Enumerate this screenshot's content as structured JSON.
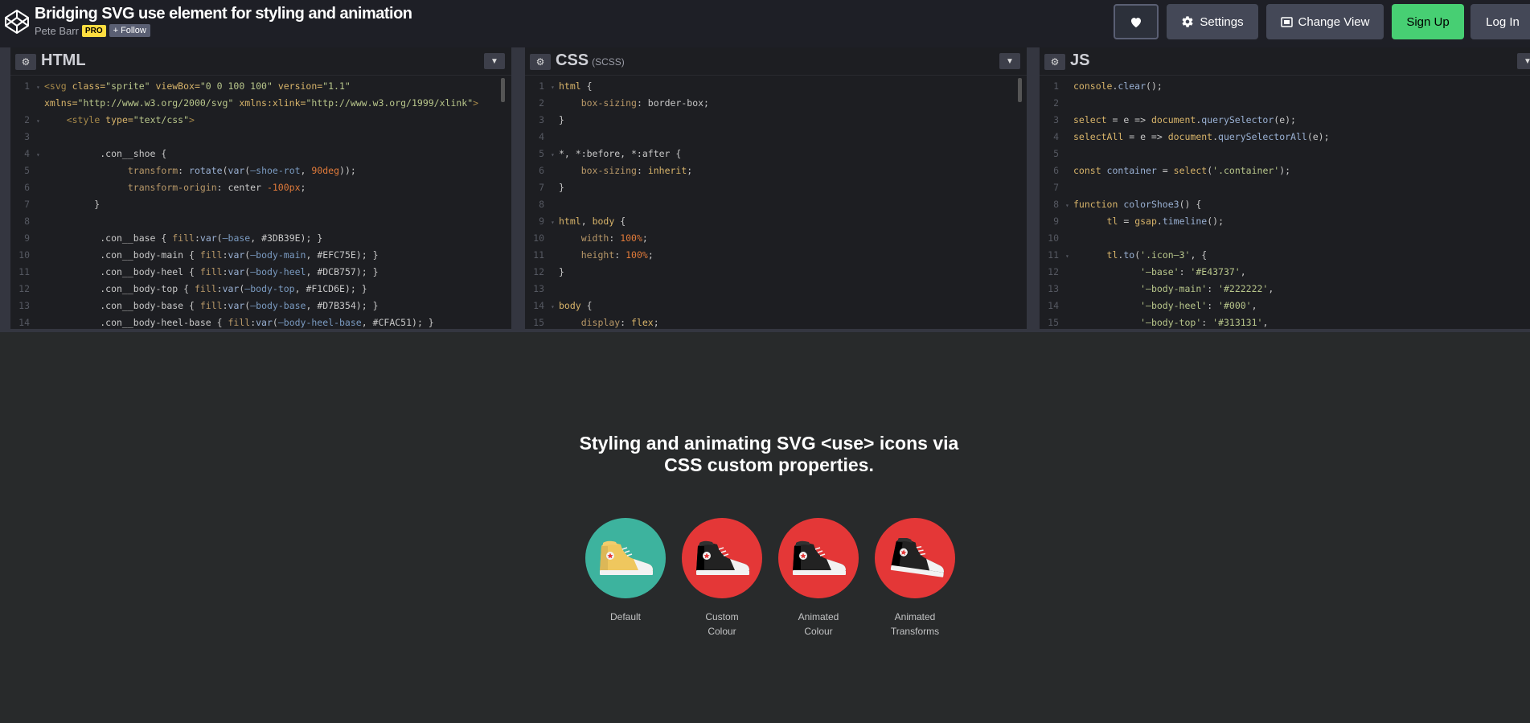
{
  "header": {
    "title": "Bridging SVG use element for styling and animation",
    "author": "Pete Barr",
    "pro_badge": "PRO",
    "follow_label": "+ Follow",
    "settings_label": "Settings",
    "change_view_label": "Change View",
    "signup_label": "Sign Up",
    "login_label": "Log In"
  },
  "panes": {
    "html": {
      "title": "HTML"
    },
    "css": {
      "title": "CSS",
      "subtitle": "(SCSS)"
    },
    "js": {
      "title": "JS"
    }
  },
  "html_code": [
    {
      "n": "1",
      "fold": "▾",
      "segs": [
        [
          "t-tag",
          "<svg "
        ],
        [
          "t-attr",
          "class="
        ],
        [
          "t-str",
          "\"sprite\""
        ],
        [
          "t-attr",
          " viewBox="
        ],
        [
          "t-str",
          "\"0 0 100 100\""
        ],
        [
          "t-attr",
          " version="
        ],
        [
          "t-str",
          "\"1.1\""
        ]
      ]
    },
    {
      "n": "",
      "fold": "",
      "segs": [
        [
          "t-attr",
          "xmlns="
        ],
        [
          "t-str",
          "\"http://www.w3.org/2000/svg\""
        ],
        [
          "t-attr",
          " xmlns:xlink="
        ],
        [
          "t-str",
          "\"http://www.w3.org/1999/xlink\""
        ],
        [
          "t-tag",
          ">"
        ]
      ]
    },
    {
      "n": "2",
      "fold": "▾",
      "segs": [
        [
          "",
          "    "
        ],
        [
          "t-tag",
          "<style "
        ],
        [
          "t-attr",
          "type="
        ],
        [
          "t-str",
          "\"text/css\""
        ],
        [
          "t-tag",
          ">"
        ]
      ]
    },
    {
      "n": "3",
      "fold": "",
      "segs": []
    },
    {
      "n": "4",
      "fold": "▾",
      "segs": [
        [
          "",
          "          .con__shoe {"
        ]
      ]
    },
    {
      "n": "5",
      "fold": "",
      "segs": [
        [
          "",
          "               "
        ],
        [
          "t-prop",
          "transform"
        ],
        [
          "",
          ": "
        ],
        [
          "t-fn",
          "rotate"
        ],
        [
          "",
          "("
        ],
        [
          "t-fn",
          "var"
        ],
        [
          "",
          "("
        ],
        [
          "t-var",
          "—shoe-rot"
        ],
        [
          "",
          ", "
        ],
        [
          "t-num",
          "90deg"
        ],
        [
          "",
          "));"
        ]
      ]
    },
    {
      "n": "6",
      "fold": "",
      "segs": [
        [
          "",
          "               "
        ],
        [
          "t-prop",
          "transform-origin"
        ],
        [
          "",
          ": center "
        ],
        [
          "t-num",
          "-100px"
        ],
        [
          "",
          ";"
        ]
      ]
    },
    {
      "n": "7",
      "fold": "",
      "segs": [
        [
          "",
          "         }"
        ]
      ]
    },
    {
      "n": "8",
      "fold": "",
      "segs": []
    },
    {
      "n": "9",
      "fold": "",
      "segs": [
        [
          "",
          "          .con__base { "
        ],
        [
          "t-prop",
          "fill"
        ],
        [
          "",
          ":"
        ],
        [
          "t-fn",
          "var"
        ],
        [
          "",
          "("
        ],
        [
          "t-var",
          "—base"
        ],
        [
          "",
          ", #3DB39E); }"
        ]
      ]
    },
    {
      "n": "10",
      "fold": "",
      "segs": [
        [
          "",
          "          .con__body-main { "
        ],
        [
          "t-prop",
          "fill"
        ],
        [
          "",
          ":"
        ],
        [
          "t-fn",
          "var"
        ],
        [
          "",
          "("
        ],
        [
          "t-var",
          "—body-main"
        ],
        [
          "",
          ", #EFC75E); }"
        ]
      ]
    },
    {
      "n": "11",
      "fold": "",
      "segs": [
        [
          "",
          "          .con__body-heel { "
        ],
        [
          "t-prop",
          "fill"
        ],
        [
          "",
          ":"
        ],
        [
          "t-fn",
          "var"
        ],
        [
          "",
          "("
        ],
        [
          "t-var",
          "—body-heel"
        ],
        [
          "",
          ", #DCB757); }"
        ]
      ]
    },
    {
      "n": "12",
      "fold": "",
      "segs": [
        [
          "",
          "          .con__body-top { "
        ],
        [
          "t-prop",
          "fill"
        ],
        [
          "",
          ":"
        ],
        [
          "t-fn",
          "var"
        ],
        [
          "",
          "("
        ],
        [
          "t-var",
          "—body-top"
        ],
        [
          "",
          ", #F1CD6E); }"
        ]
      ]
    },
    {
      "n": "13",
      "fold": "",
      "segs": [
        [
          "",
          "          .con__body-base { "
        ],
        [
          "t-prop",
          "fill"
        ],
        [
          "",
          ":"
        ],
        [
          "t-fn",
          "var"
        ],
        [
          "",
          "("
        ],
        [
          "t-var",
          "—body-base"
        ],
        [
          "",
          ", #D7B354); }"
        ]
      ]
    },
    {
      "n": "14",
      "fold": "",
      "segs": [
        [
          "",
          "          .con__body-heel-base { "
        ],
        [
          "t-prop",
          "fill"
        ],
        [
          "",
          ":"
        ],
        [
          "t-fn",
          "var"
        ],
        [
          "",
          "("
        ],
        [
          "t-var",
          "—body-heel-base"
        ],
        [
          "",
          ", #CFAC51); }"
        ]
      ]
    }
  ],
  "css_code": [
    {
      "n": "1",
      "fold": "▾",
      "segs": [
        [
          "t-kw",
          "html"
        ],
        [
          "",
          " {"
        ]
      ]
    },
    {
      "n": "2",
      "fold": "",
      "segs": [
        [
          "",
          "    "
        ],
        [
          "t-prop",
          "box-sizing"
        ],
        [
          "",
          ": border-box;"
        ]
      ]
    },
    {
      "n": "3",
      "fold": "",
      "segs": [
        [
          "",
          "}"
        ]
      ]
    },
    {
      "n": "4",
      "fold": "",
      "segs": []
    },
    {
      "n": "5",
      "fold": "▾",
      "segs": [
        [
          "",
          "*, *:before, *:after {"
        ]
      ]
    },
    {
      "n": "6",
      "fold": "",
      "segs": [
        [
          "",
          "    "
        ],
        [
          "t-prop",
          "box-sizing"
        ],
        [
          "",
          ": "
        ],
        [
          "t-kw",
          "inherit"
        ],
        [
          "",
          ";"
        ]
      ]
    },
    {
      "n": "7",
      "fold": "",
      "segs": [
        [
          "",
          "}"
        ]
      ]
    },
    {
      "n": "8",
      "fold": "",
      "segs": []
    },
    {
      "n": "9",
      "fold": "▾",
      "segs": [
        [
          "t-kw",
          "html"
        ],
        [
          "",
          ", "
        ],
        [
          "t-kw",
          "body"
        ],
        [
          "",
          " {"
        ]
      ]
    },
    {
      "n": "10",
      "fold": "",
      "segs": [
        [
          "",
          "    "
        ],
        [
          "t-prop",
          "width"
        ],
        [
          "",
          ": "
        ],
        [
          "t-num",
          "100%"
        ],
        [
          "",
          ";"
        ]
      ]
    },
    {
      "n": "11",
      "fold": "",
      "segs": [
        [
          "",
          "    "
        ],
        [
          "t-prop",
          "height"
        ],
        [
          "",
          ": "
        ],
        [
          "t-num",
          "100%"
        ],
        [
          "",
          ";"
        ]
      ]
    },
    {
      "n": "12",
      "fold": "",
      "segs": [
        [
          "",
          "}"
        ]
      ]
    },
    {
      "n": "13",
      "fold": "",
      "segs": []
    },
    {
      "n": "14",
      "fold": "▾",
      "segs": [
        [
          "t-kw",
          "body"
        ],
        [
          "",
          " {"
        ]
      ]
    },
    {
      "n": "15",
      "fold": "",
      "segs": [
        [
          "",
          "    "
        ],
        [
          "t-prop",
          "display"
        ],
        [
          "",
          ": "
        ],
        [
          "t-kw",
          "flex"
        ],
        [
          "",
          ";"
        ]
      ]
    }
  ],
  "js_code": [
    {
      "n": "1",
      "fold": "",
      "segs": [
        [
          "t-kw",
          "console"
        ],
        [
          "",
          "."
        ],
        [
          "t-fn",
          "clear"
        ],
        [
          "",
          "();"
        ]
      ]
    },
    {
      "n": "2",
      "fold": "",
      "segs": []
    },
    {
      "n": "3",
      "fold": "",
      "segs": [
        [
          "t-kw",
          "select"
        ],
        [
          "",
          " = e => "
        ],
        [
          "t-kw",
          "document"
        ],
        [
          "",
          "."
        ],
        [
          "t-fn",
          "querySelector"
        ],
        [
          "",
          "(e);"
        ]
      ]
    },
    {
      "n": "4",
      "fold": "",
      "segs": [
        [
          "t-kw",
          "selectAll"
        ],
        [
          "",
          " = e => "
        ],
        [
          "t-kw",
          "document"
        ],
        [
          "",
          "."
        ],
        [
          "t-fn",
          "querySelectorAll"
        ],
        [
          "",
          "(e);"
        ]
      ]
    },
    {
      "n": "5",
      "fold": "",
      "segs": []
    },
    {
      "n": "6",
      "fold": "",
      "segs": [
        [
          "t-kw",
          "const"
        ],
        [
          "t-fn",
          " container"
        ],
        [
          "",
          " = "
        ],
        [
          "t-kw",
          "select"
        ],
        [
          "",
          "("
        ],
        [
          "t-str",
          "'.container'"
        ],
        [
          "",
          ");"
        ]
      ]
    },
    {
      "n": "7",
      "fold": "",
      "segs": []
    },
    {
      "n": "8",
      "fold": "▾",
      "segs": [
        [
          "t-kw",
          "function"
        ],
        [
          "",
          " "
        ],
        [
          "t-fn",
          "colorShoe3"
        ],
        [
          "",
          "() {"
        ]
      ]
    },
    {
      "n": "9",
      "fold": "",
      "segs": [
        [
          "",
          "      "
        ],
        [
          "t-kw",
          "tl"
        ],
        [
          "",
          " = "
        ],
        [
          "t-kw",
          "gsap"
        ],
        [
          "",
          "."
        ],
        [
          "t-fn",
          "timeline"
        ],
        [
          "",
          "();"
        ]
      ]
    },
    {
      "n": "10",
      "fold": "",
      "segs": []
    },
    {
      "n": "11",
      "fold": "▾",
      "segs": [
        [
          "",
          "      "
        ],
        [
          "t-kw",
          "tl"
        ],
        [
          "",
          "."
        ],
        [
          "t-fn",
          "to"
        ],
        [
          "",
          "("
        ],
        [
          "t-str",
          "'.icon—3'"
        ],
        [
          "",
          ", {"
        ]
      ]
    },
    {
      "n": "12",
      "fold": "",
      "segs": [
        [
          "",
          "            "
        ],
        [
          "t-str",
          "'—base'"
        ],
        [
          "",
          ": "
        ],
        [
          "t-str",
          "'#E43737'"
        ],
        [
          "",
          ","
        ]
      ]
    },
    {
      "n": "13",
      "fold": "",
      "segs": [
        [
          "",
          "            "
        ],
        [
          "t-str",
          "'—body-main'"
        ],
        [
          "",
          ": "
        ],
        [
          "t-str",
          "'#222222'"
        ],
        [
          "",
          ","
        ]
      ]
    },
    {
      "n": "14",
      "fold": "",
      "segs": [
        [
          "",
          "            "
        ],
        [
          "t-str",
          "'—body-heel'"
        ],
        [
          "",
          ": "
        ],
        [
          "t-str",
          "'#000'"
        ],
        [
          "",
          ","
        ]
      ]
    },
    {
      "n": "15",
      "fold": "",
      "segs": [
        [
          "",
          "            "
        ],
        [
          "t-str",
          "'—body-top'"
        ],
        [
          "",
          ": "
        ],
        [
          "t-str",
          "'#313131'"
        ],
        [
          "",
          ","
        ]
      ]
    }
  ],
  "preview": {
    "heading_line1": "Styling and animating SVG <use> icons via",
    "heading_line2": "CSS custom properties.",
    "icons": [
      {
        "caption1": "Default",
        "caption2": "",
        "base": "#3DB39E",
        "body": "#EFC75E",
        "heel": "#DCB757",
        "top": "#F1CD6E"
      },
      {
        "caption1": "Custom",
        "caption2": "Colour",
        "base": "#E43737",
        "body": "#222222",
        "heel": "#000000",
        "top": "#313131"
      },
      {
        "caption1": "Animated",
        "caption2": "Colour",
        "base": "#E43737",
        "body": "#222222",
        "heel": "#000000",
        "top": "#313131"
      },
      {
        "caption1": "Animated",
        "caption2": "Transforms",
        "base": "#E43737",
        "body": "#222222",
        "heel": "#000000",
        "top": "#313131"
      }
    ]
  },
  "colors": {
    "signup": "#47cf73",
    "pro": "#ffdd40"
  }
}
